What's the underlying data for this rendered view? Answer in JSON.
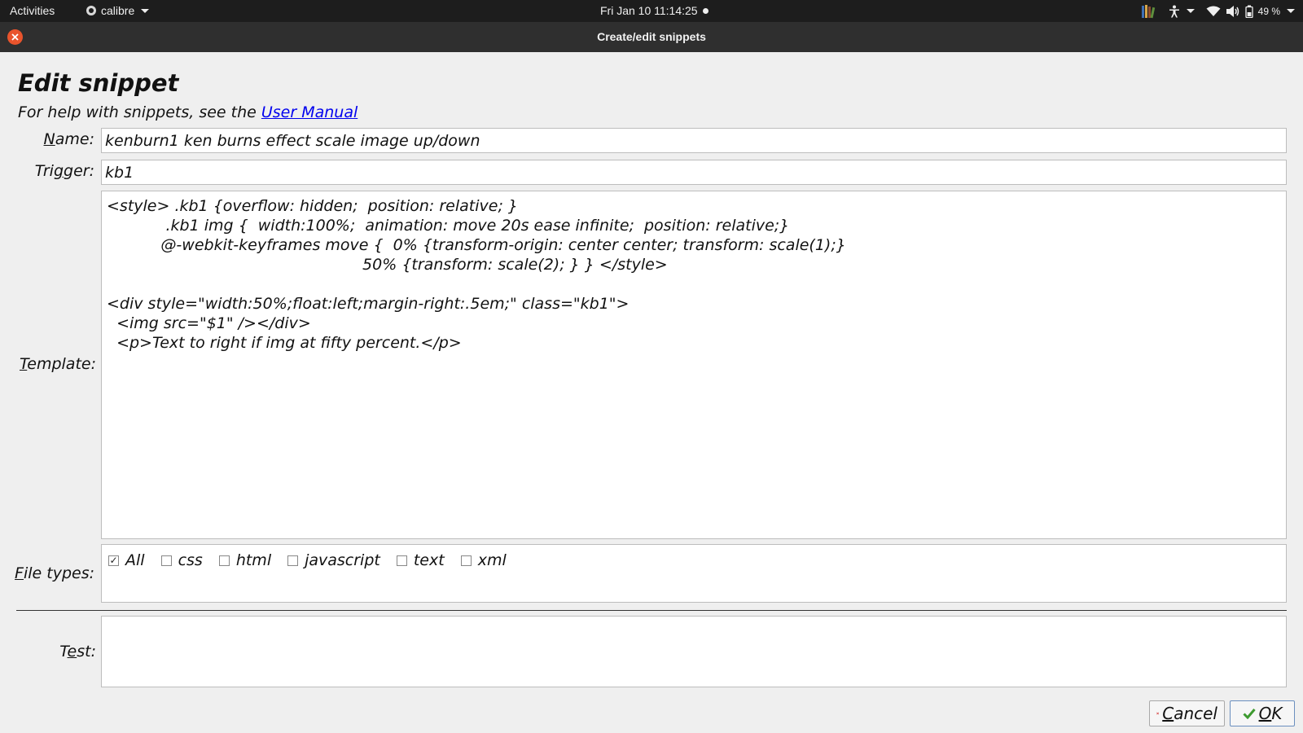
{
  "topbar": {
    "activities": "Activities",
    "app_name": "calibre",
    "datetime": "Fri Jan 10  11:14:25",
    "battery": "49 %"
  },
  "window": {
    "title": "Create/edit snippets"
  },
  "dialog": {
    "heading": "Edit snippet",
    "help_prefix": "For help with snippets, see the ",
    "help_link": "User Manual",
    "labels": {
      "name_rest": "ame:",
      "name_key": "N",
      "trigger_pre": "Tri",
      "trigger_key": "g",
      "trigger_rest": "ger:",
      "template_key": "T",
      "template_rest": "emplate:",
      "filetypes_key": "F",
      "filetypes_rest": "ile types:",
      "test_pre": "T",
      "test_key": "e",
      "test_rest": "st:"
    },
    "name_value": "kenburn1 ken burns effect scale image up/down",
    "trigger_value": "kb1",
    "template_value": "<style> .kb1 {overflow: hidden;  position: relative; }\n            .kb1 img {  width:100%;  animation: move 20s ease infinite;  position: relative;}\n           @-webkit-keyframes move {  0% {transform-origin: center center; transform: scale(1);}\n                                                    50% {transform: scale(2); } } </style>\n\n<div style=\"width:50%;float:left;margin-right:.5em;\" class=\"kb1\">\n  <img src=\"$1\" /></div>\n  <p>Text to right if img at fifty percent.</p>",
    "file_types": [
      {
        "label": "All",
        "checked": true
      },
      {
        "label": "css",
        "checked": false
      },
      {
        "label": "html",
        "checked": false
      },
      {
        "label": "javascript",
        "checked": false
      },
      {
        "label": "text",
        "checked": false
      },
      {
        "label": "xml",
        "checked": false
      }
    ],
    "test_value": "",
    "buttons": {
      "cancel_key": "C",
      "cancel_rest": "ancel",
      "ok_key": "O",
      "ok_rest": "K"
    }
  }
}
